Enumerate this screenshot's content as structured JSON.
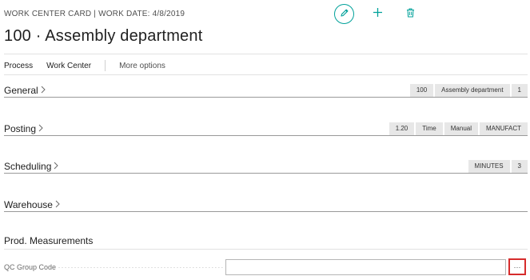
{
  "header": {
    "caption": "WORK CENTER CARD | WORK DATE: 4/8/2019",
    "title": "100 · Assembly department"
  },
  "toolbar": {
    "edit_icon": "pencil-icon",
    "new_icon": "plus-icon",
    "delete_icon": "trash-icon",
    "accent_color": "#00a19a"
  },
  "actionbar": {
    "items": [
      "Process",
      "Work Center"
    ],
    "more": "More options"
  },
  "sections": [
    {
      "title": "General",
      "summary": [
        "100",
        "Assembly department",
        "1"
      ]
    },
    {
      "title": "Posting",
      "summary": [
        "1.20",
        "Time",
        "Manual",
        "MANUFACT"
      ]
    },
    {
      "title": "Scheduling",
      "summary": [
        "MINUTES",
        "3"
      ]
    },
    {
      "title": "Warehouse",
      "summary": []
    }
  ],
  "prod_measurements": {
    "title": "Prod. Measurements",
    "qc_label": "QC Group Code",
    "qc_value": "",
    "lookup_label": "···"
  }
}
